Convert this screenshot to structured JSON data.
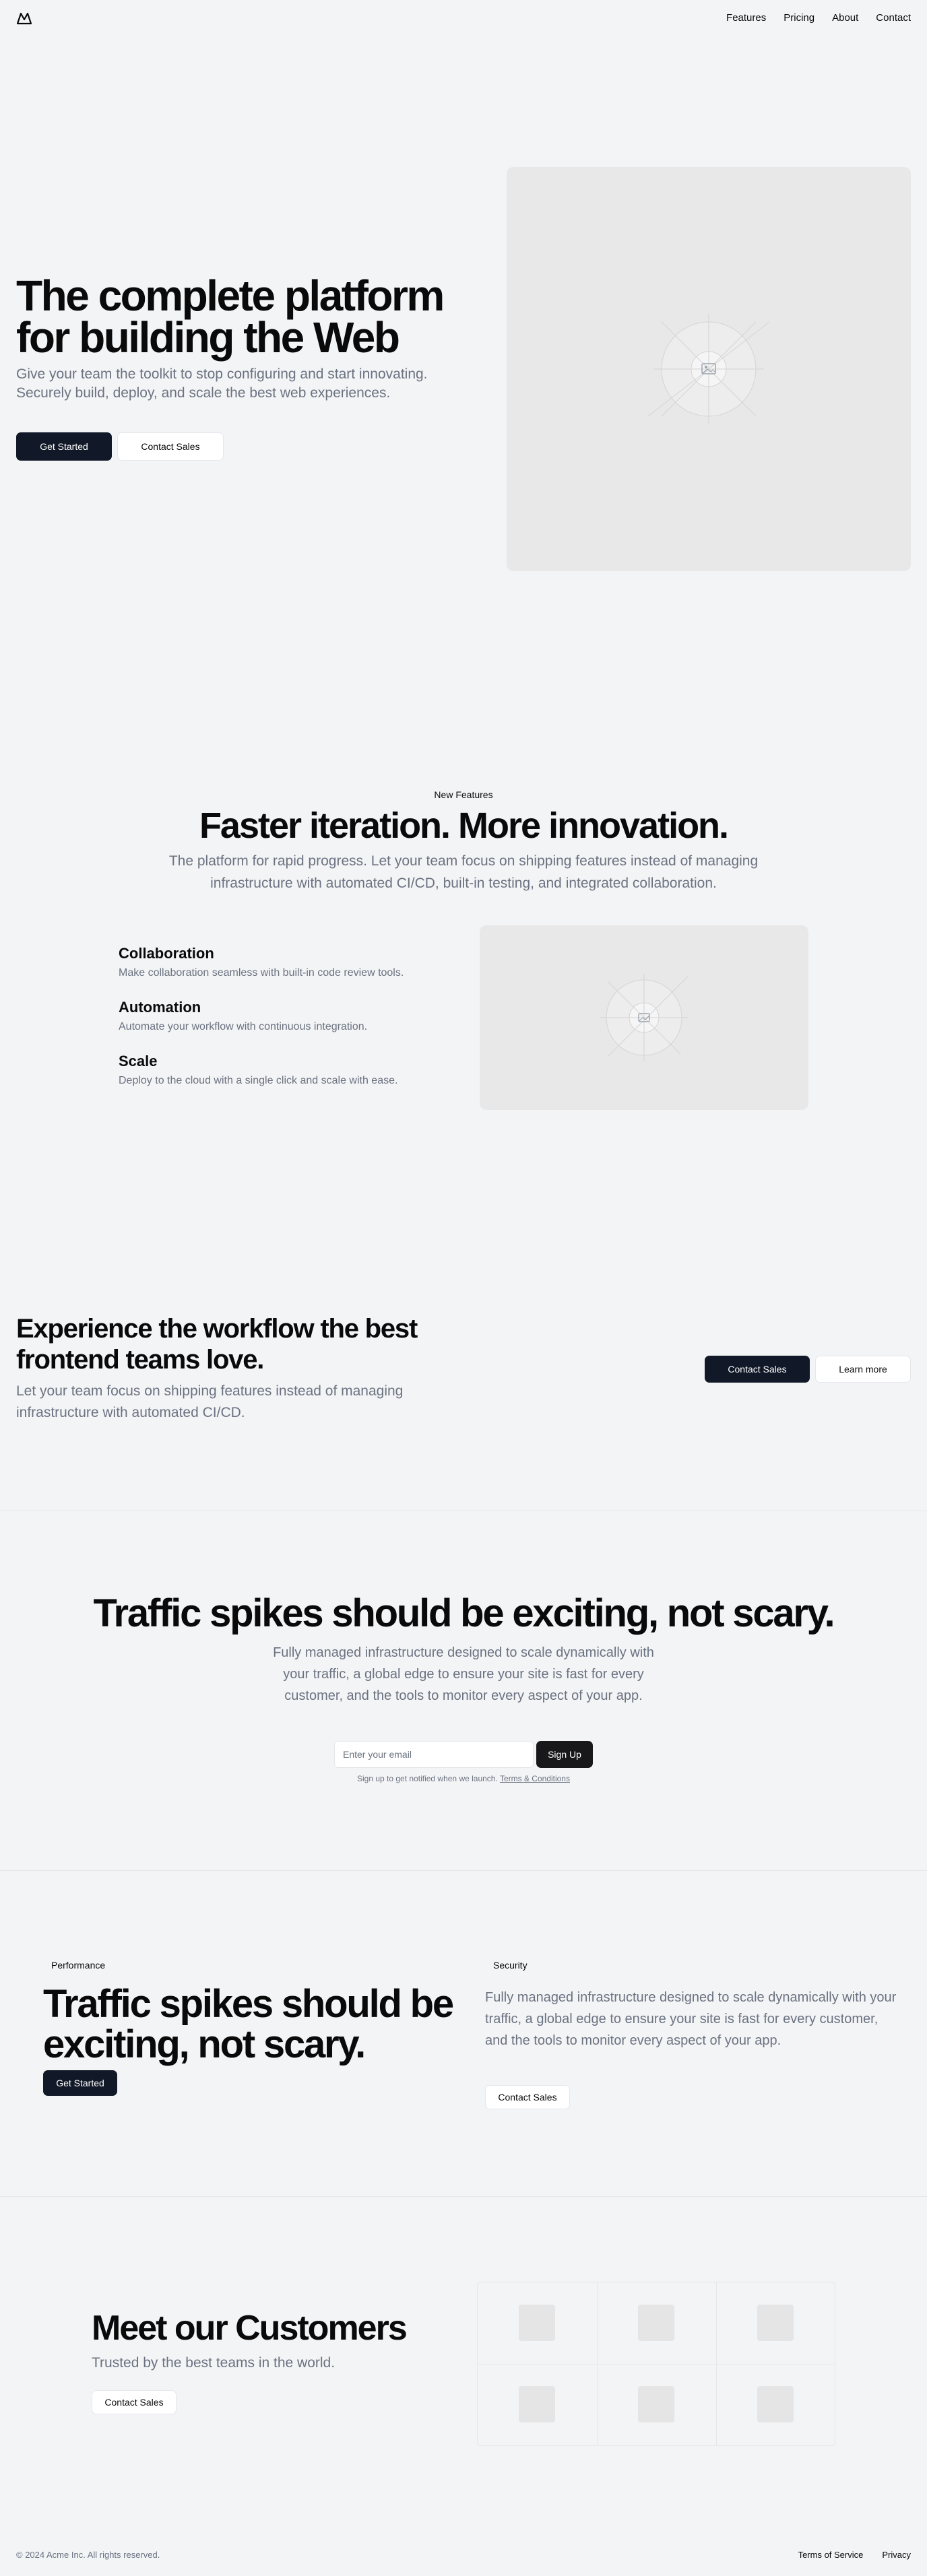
{
  "header": {
    "logo_icon": "mountain-icon",
    "nav": [
      "Features",
      "Pricing",
      "About",
      "Contact"
    ]
  },
  "hero": {
    "title": "The complete platform for building the Web",
    "description": "Give your team the toolkit to stop configuring and start innovating. Securely build, deploy, and scale the best web experiences.",
    "primary_button": "Get Started",
    "secondary_button": "Contact Sales",
    "image_icon": "image-placeholder-icon"
  },
  "features": {
    "eyebrow": "New Features",
    "title": "Faster iteration. More innovation.",
    "description": "The platform for rapid progress. Let your team focus on shipping features instead of managing infrastructure with automated CI/CD, built-in testing, and integrated collaboration.",
    "items": [
      {
        "title": "Collaboration",
        "description": "Make collaboration seamless with built-in code review tools."
      },
      {
        "title": "Automation",
        "description": "Automate your workflow with continuous integration."
      },
      {
        "title": "Scale",
        "description": "Deploy to the cloud with a single click and scale with ease."
      }
    ]
  },
  "cta": {
    "title": "Experience the workflow the best frontend teams love.",
    "description": "Let your team focus on shipping features instead of managing infrastructure with automated CI/CD.",
    "primary_button": "Contact Sales",
    "secondary_button": "Learn more"
  },
  "signup": {
    "title": "Traffic spikes should be exciting, not scary.",
    "description": "Fully managed infrastructure designed to scale dynamically with your traffic, a global edge to ensure your site is fast for every customer, and the tools to monitor every aspect of your app.",
    "email_placeholder": "Enter your email",
    "button": "Sign Up",
    "note": "Sign up to get notified when we launch.",
    "terms_link": "Terms & Conditions"
  },
  "split": {
    "left_badge": "Performance",
    "left_title": "Traffic spikes should be exciting, not scary.",
    "left_button": "Get Started",
    "right_badge": "Security",
    "right_description": "Fully managed infrastructure designed to scale dynamically with your traffic, a global edge to ensure your site is fast for every customer, and the tools to monitor every aspect of your app.",
    "right_button": "Contact Sales"
  },
  "customers": {
    "title": "Meet our Customers",
    "description": "Trusted by the best teams in the world.",
    "button": "Contact Sales",
    "logo_count": 6
  },
  "footer": {
    "copyright": "© 2024 Acme Inc. All rights reserved.",
    "links": [
      "Terms of Service",
      "Privacy"
    ]
  },
  "colors": {
    "background": "#f3f4f6",
    "primary_button": "#111827",
    "muted_text": "#6b7280"
  }
}
